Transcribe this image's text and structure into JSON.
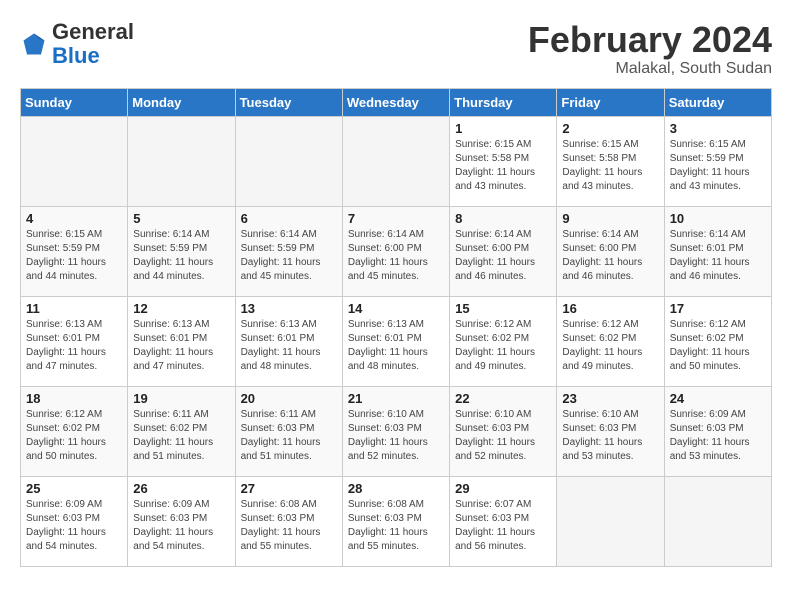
{
  "header": {
    "logo_general": "General",
    "logo_blue": "Blue",
    "title": "February 2024",
    "subtitle": "Malakal, South Sudan"
  },
  "columns": [
    "Sunday",
    "Monday",
    "Tuesday",
    "Wednesday",
    "Thursday",
    "Friday",
    "Saturday"
  ],
  "weeks": [
    [
      {
        "day": "",
        "sunrise": "",
        "sunset": "",
        "daylight": "",
        "empty": true
      },
      {
        "day": "",
        "sunrise": "",
        "sunset": "",
        "daylight": "",
        "empty": true
      },
      {
        "day": "",
        "sunrise": "",
        "sunset": "",
        "daylight": "",
        "empty": true
      },
      {
        "day": "",
        "sunrise": "",
        "sunset": "",
        "daylight": "",
        "empty": true
      },
      {
        "day": "1",
        "sunrise": "Sunrise: 6:15 AM",
        "sunset": "Sunset: 5:58 PM",
        "daylight": "Daylight: 11 hours and 43 minutes.",
        "empty": false
      },
      {
        "day": "2",
        "sunrise": "Sunrise: 6:15 AM",
        "sunset": "Sunset: 5:58 PM",
        "daylight": "Daylight: 11 hours and 43 minutes.",
        "empty": false
      },
      {
        "day": "3",
        "sunrise": "Sunrise: 6:15 AM",
        "sunset": "Sunset: 5:59 PM",
        "daylight": "Daylight: 11 hours and 43 minutes.",
        "empty": false
      }
    ],
    [
      {
        "day": "4",
        "sunrise": "Sunrise: 6:15 AM",
        "sunset": "Sunset: 5:59 PM",
        "daylight": "Daylight: 11 hours and 44 minutes.",
        "empty": false
      },
      {
        "day": "5",
        "sunrise": "Sunrise: 6:14 AM",
        "sunset": "Sunset: 5:59 PM",
        "daylight": "Daylight: 11 hours and 44 minutes.",
        "empty": false
      },
      {
        "day": "6",
        "sunrise": "Sunrise: 6:14 AM",
        "sunset": "Sunset: 5:59 PM",
        "daylight": "Daylight: 11 hours and 45 minutes.",
        "empty": false
      },
      {
        "day": "7",
        "sunrise": "Sunrise: 6:14 AM",
        "sunset": "Sunset: 6:00 PM",
        "daylight": "Daylight: 11 hours and 45 minutes.",
        "empty": false
      },
      {
        "day": "8",
        "sunrise": "Sunrise: 6:14 AM",
        "sunset": "Sunset: 6:00 PM",
        "daylight": "Daylight: 11 hours and 46 minutes.",
        "empty": false
      },
      {
        "day": "9",
        "sunrise": "Sunrise: 6:14 AM",
        "sunset": "Sunset: 6:00 PM",
        "daylight": "Daylight: 11 hours and 46 minutes.",
        "empty": false
      },
      {
        "day": "10",
        "sunrise": "Sunrise: 6:14 AM",
        "sunset": "Sunset: 6:01 PM",
        "daylight": "Daylight: 11 hours and 46 minutes.",
        "empty": false
      }
    ],
    [
      {
        "day": "11",
        "sunrise": "Sunrise: 6:13 AM",
        "sunset": "Sunset: 6:01 PM",
        "daylight": "Daylight: 11 hours and 47 minutes.",
        "empty": false
      },
      {
        "day": "12",
        "sunrise": "Sunrise: 6:13 AM",
        "sunset": "Sunset: 6:01 PM",
        "daylight": "Daylight: 11 hours and 47 minutes.",
        "empty": false
      },
      {
        "day": "13",
        "sunrise": "Sunrise: 6:13 AM",
        "sunset": "Sunset: 6:01 PM",
        "daylight": "Daylight: 11 hours and 48 minutes.",
        "empty": false
      },
      {
        "day": "14",
        "sunrise": "Sunrise: 6:13 AM",
        "sunset": "Sunset: 6:01 PM",
        "daylight": "Daylight: 11 hours and 48 minutes.",
        "empty": false
      },
      {
        "day": "15",
        "sunrise": "Sunrise: 6:12 AM",
        "sunset": "Sunset: 6:02 PM",
        "daylight": "Daylight: 11 hours and 49 minutes.",
        "empty": false
      },
      {
        "day": "16",
        "sunrise": "Sunrise: 6:12 AM",
        "sunset": "Sunset: 6:02 PM",
        "daylight": "Daylight: 11 hours and 49 minutes.",
        "empty": false
      },
      {
        "day": "17",
        "sunrise": "Sunrise: 6:12 AM",
        "sunset": "Sunset: 6:02 PM",
        "daylight": "Daylight: 11 hours and 50 minutes.",
        "empty": false
      }
    ],
    [
      {
        "day": "18",
        "sunrise": "Sunrise: 6:12 AM",
        "sunset": "Sunset: 6:02 PM",
        "daylight": "Daylight: 11 hours and 50 minutes.",
        "empty": false
      },
      {
        "day": "19",
        "sunrise": "Sunrise: 6:11 AM",
        "sunset": "Sunset: 6:02 PM",
        "daylight": "Daylight: 11 hours and 51 minutes.",
        "empty": false
      },
      {
        "day": "20",
        "sunrise": "Sunrise: 6:11 AM",
        "sunset": "Sunset: 6:03 PM",
        "daylight": "Daylight: 11 hours and 51 minutes.",
        "empty": false
      },
      {
        "day": "21",
        "sunrise": "Sunrise: 6:10 AM",
        "sunset": "Sunset: 6:03 PM",
        "daylight": "Daylight: 11 hours and 52 minutes.",
        "empty": false
      },
      {
        "day": "22",
        "sunrise": "Sunrise: 6:10 AM",
        "sunset": "Sunset: 6:03 PM",
        "daylight": "Daylight: 11 hours and 52 minutes.",
        "empty": false
      },
      {
        "day": "23",
        "sunrise": "Sunrise: 6:10 AM",
        "sunset": "Sunset: 6:03 PM",
        "daylight": "Daylight: 11 hours and 53 minutes.",
        "empty": false
      },
      {
        "day": "24",
        "sunrise": "Sunrise: 6:09 AM",
        "sunset": "Sunset: 6:03 PM",
        "daylight": "Daylight: 11 hours and 53 minutes.",
        "empty": false
      }
    ],
    [
      {
        "day": "25",
        "sunrise": "Sunrise: 6:09 AM",
        "sunset": "Sunset: 6:03 PM",
        "daylight": "Daylight: 11 hours and 54 minutes.",
        "empty": false
      },
      {
        "day": "26",
        "sunrise": "Sunrise: 6:09 AM",
        "sunset": "Sunset: 6:03 PM",
        "daylight": "Daylight: 11 hours and 54 minutes.",
        "empty": false
      },
      {
        "day": "27",
        "sunrise": "Sunrise: 6:08 AM",
        "sunset": "Sunset: 6:03 PM",
        "daylight": "Daylight: 11 hours and 55 minutes.",
        "empty": false
      },
      {
        "day": "28",
        "sunrise": "Sunrise: 6:08 AM",
        "sunset": "Sunset: 6:03 PM",
        "daylight": "Daylight: 11 hours and 55 minutes.",
        "empty": false
      },
      {
        "day": "29",
        "sunrise": "Sunrise: 6:07 AM",
        "sunset": "Sunset: 6:03 PM",
        "daylight": "Daylight: 11 hours and 56 minutes.",
        "empty": false
      },
      {
        "day": "",
        "sunrise": "",
        "sunset": "",
        "daylight": "",
        "empty": true
      },
      {
        "day": "",
        "sunrise": "",
        "sunset": "",
        "daylight": "",
        "empty": true
      }
    ]
  ]
}
